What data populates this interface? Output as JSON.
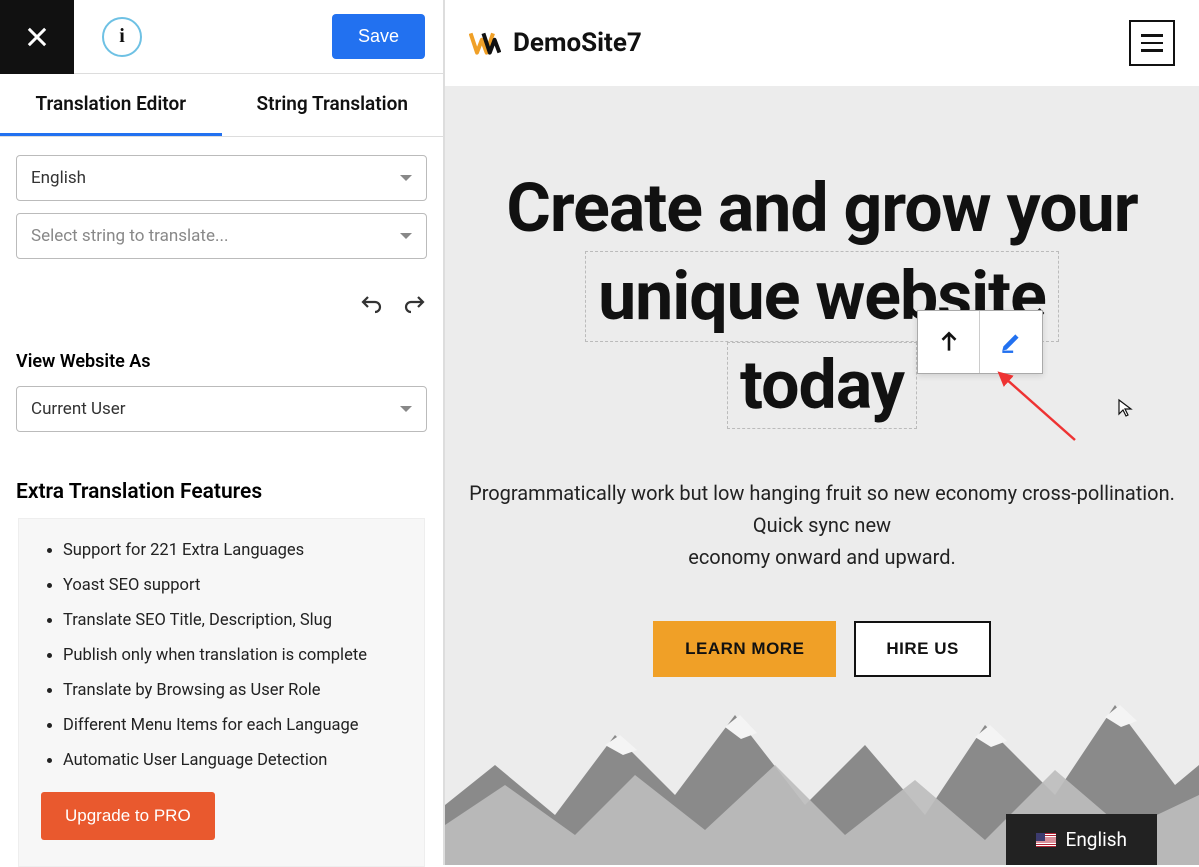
{
  "toolbar": {
    "save_label": "Save"
  },
  "tabs": {
    "editor": "Translation Editor",
    "string": "String Translation"
  },
  "selects": {
    "language": "English",
    "string_placeholder": "Select string to translate..."
  },
  "view_as": {
    "label": "View Website As",
    "value": "Current User"
  },
  "extra": {
    "title": "Extra Translation Features",
    "items": [
      "Support for 221 Extra Languages",
      "Yoast SEO support",
      "Translate SEO Title, Description, Slug",
      "Publish only when translation is complete",
      "Translate by Browsing as User Role",
      "Different Menu Items for each Language",
      "Automatic User Language Detection"
    ],
    "upgrade": "Upgrade to PRO"
  },
  "preview": {
    "site_title": "DemoSite7",
    "heading_line1": "Create and grow your",
    "heading_line2": "unique website",
    "heading_line3": "today",
    "sub1": "Programmatically work but low hanging fruit so new economy cross-pollination.",
    "sub2": "Quick sync new",
    "sub3": "economy onward and upward.",
    "btn_primary": "LEARN MORE",
    "btn_secondary": "HIRE US",
    "lang": "English"
  }
}
